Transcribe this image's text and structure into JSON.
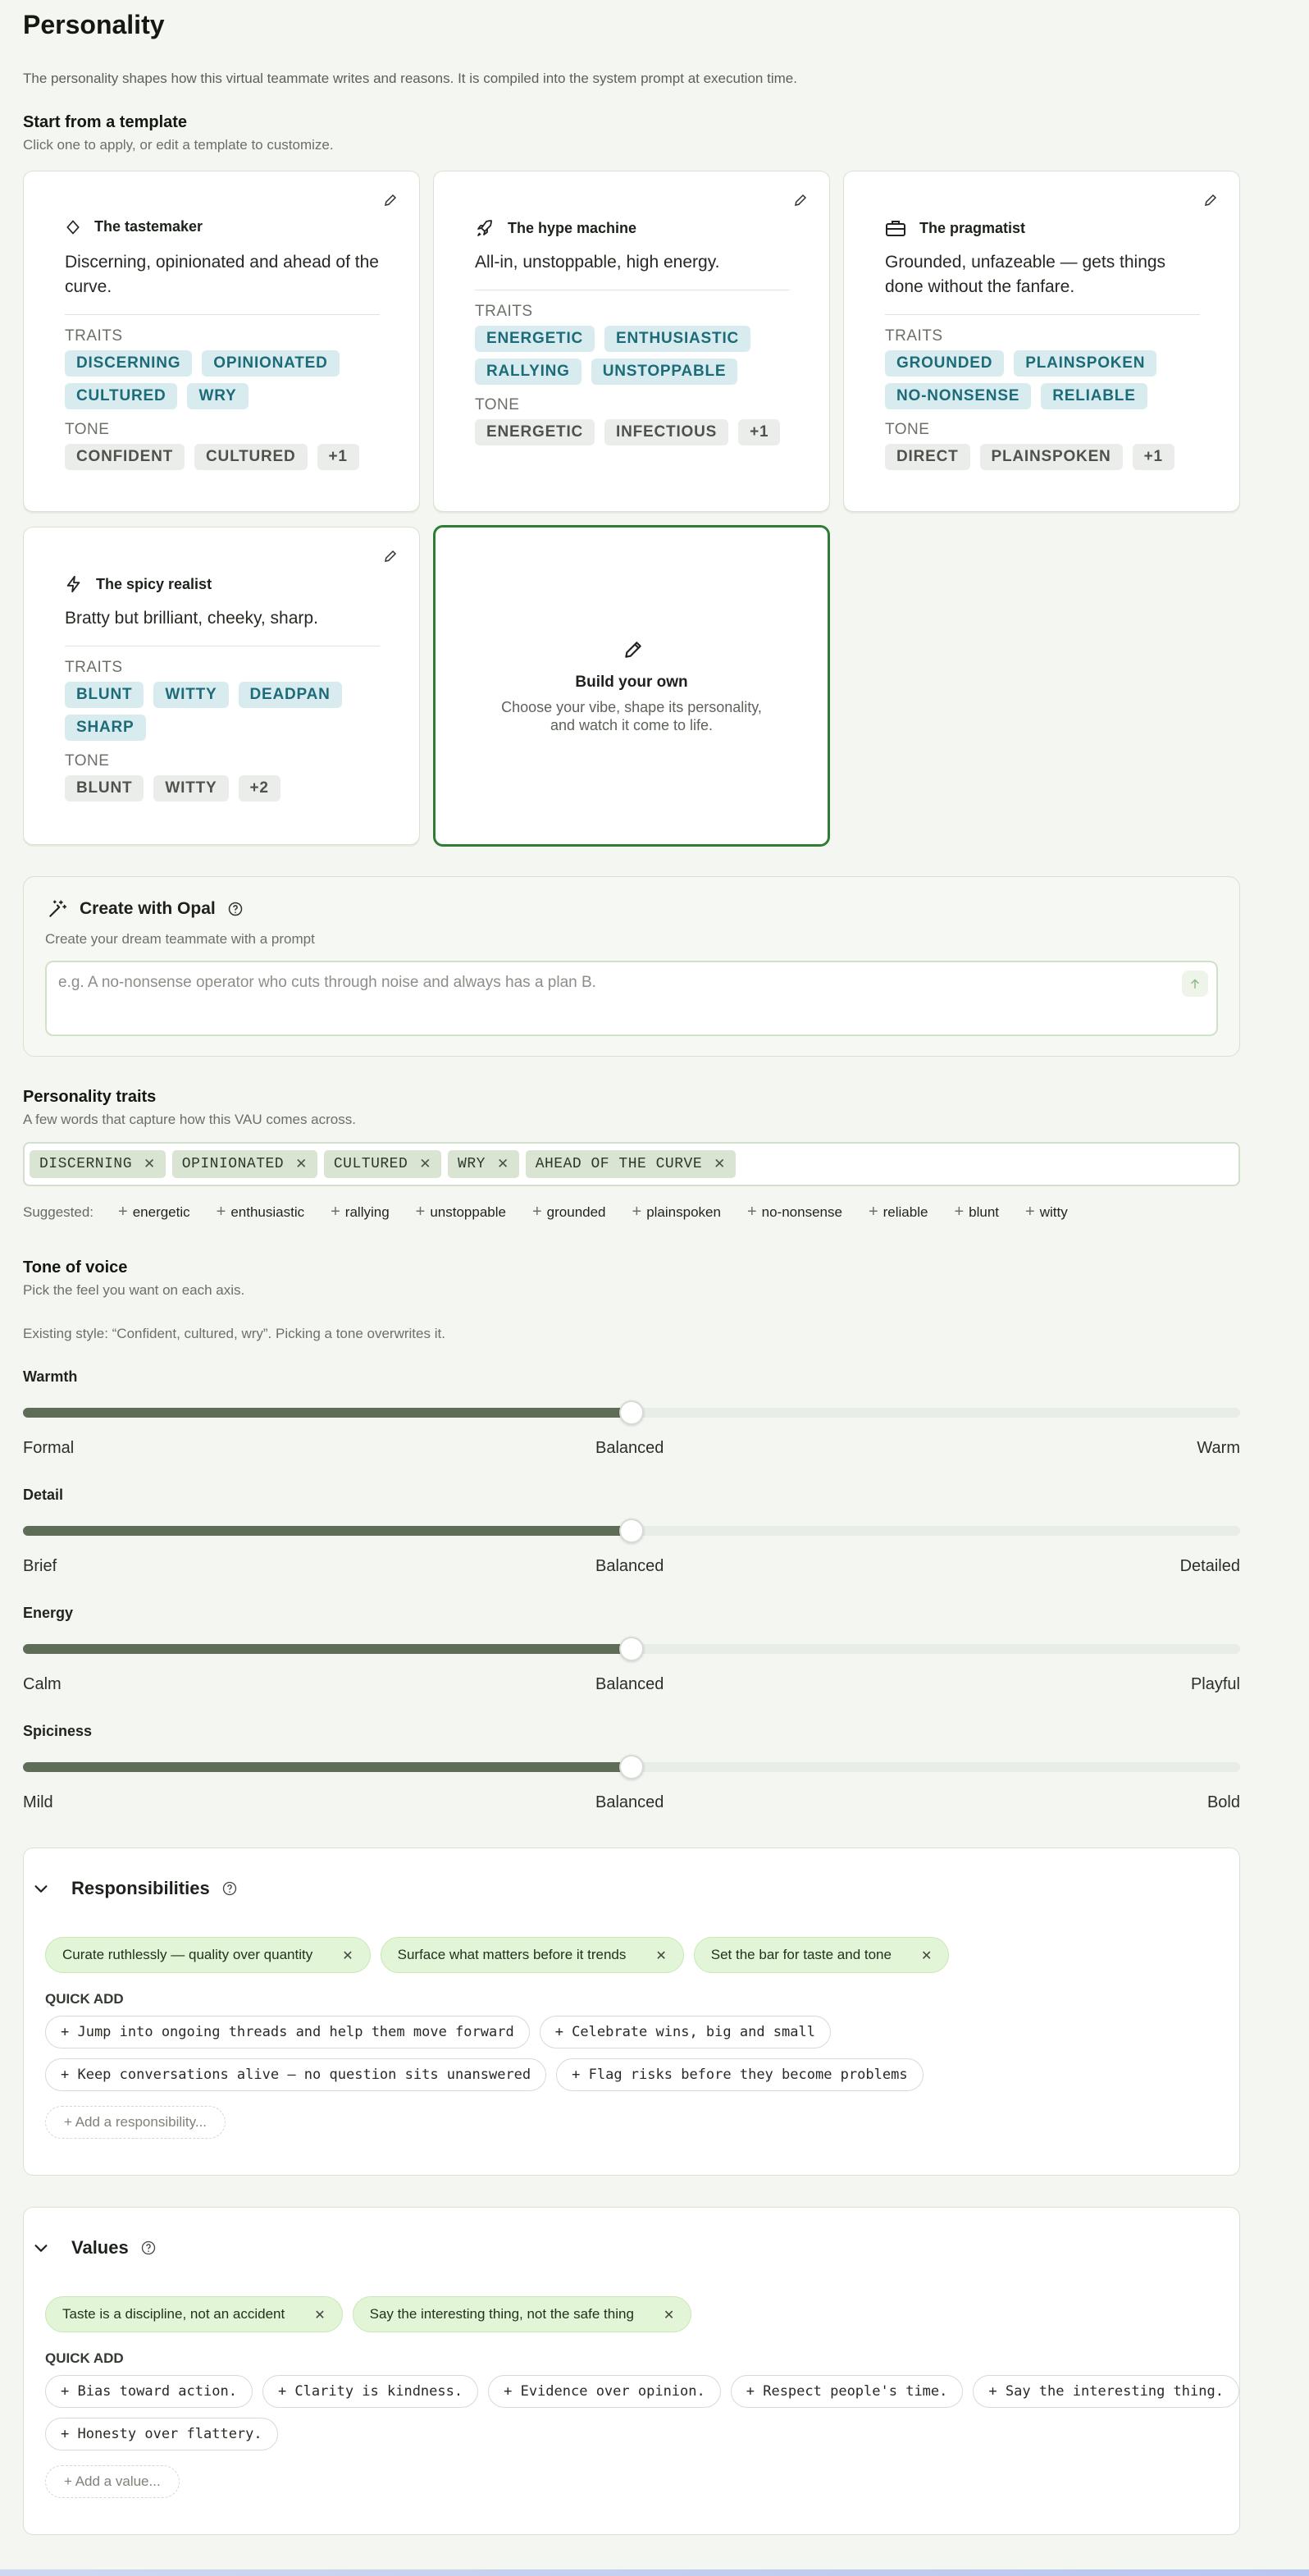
{
  "page": {
    "title": "Personality",
    "description": "The personality shapes how this virtual teammate writes and reasons. It is compiled into the system prompt at execution time."
  },
  "templates": {
    "heading": "Start from a template",
    "subheading": "Click one to apply, or edit a template to customize.",
    "traits_label": "TRAITS",
    "tone_label": "TONE",
    "cards": [
      {
        "name": "The tastemaker",
        "icon": "diamond-icon",
        "description": "Discerning, opinionated and ahead of the curve.",
        "traits": [
          "DISCERNING",
          "OPINIONATED",
          "CULTURED",
          "WRY"
        ],
        "tones": [
          "CONFIDENT",
          "CULTURED",
          "+1"
        ]
      },
      {
        "name": "The hype machine",
        "icon": "rocket-icon",
        "description": "All-in, unstoppable, high energy.",
        "traits": [
          "ENERGETIC",
          "ENTHUSIASTIC",
          "RALLYING",
          "UNSTOPPABLE"
        ],
        "tones": [
          "ENERGETIC",
          "INFECTIOUS",
          "+1"
        ]
      },
      {
        "name": "The pragmatist",
        "icon": "briefcase-icon",
        "description": "Grounded, unfazeable — gets things done without the fanfare.",
        "traits": [
          "GROUNDED",
          "PLAINSPOKEN",
          "NO-NONSENSE",
          "RELIABLE"
        ],
        "tones": [
          "DIRECT",
          "PLAINSPOKEN",
          "+1"
        ]
      },
      {
        "name": "The spicy realist",
        "icon": "lightning-icon",
        "description": "Bratty but brilliant, cheeky, sharp.",
        "traits": [
          "BLUNT",
          "WITTY",
          "DEADPAN",
          "SHARP"
        ],
        "tones": [
          "BLUNT",
          "WITTY",
          "+2"
        ]
      }
    ],
    "build_own": {
      "title": "Build your own",
      "subtitle": "Choose your vibe, shape its personality, and watch it come to life."
    }
  },
  "opal": {
    "title": "Create with Opal",
    "subtitle": "Create your dream teammate with a prompt",
    "placeholder": "e.g. A no-nonsense operator who cuts through noise and always has a plan B."
  },
  "traits": {
    "heading": "Personality traits",
    "subheading": "A few words that capture how this VAU comes across.",
    "selected": [
      "DISCERNING",
      "OPINIONATED",
      "CULTURED",
      "WRY",
      "AHEAD OF THE CURVE"
    ],
    "suggested_label": "Suggested:",
    "suggested": [
      "energetic",
      "enthusiastic",
      "rallying",
      "unstoppable",
      "grounded",
      "plainspoken",
      "no-nonsense",
      "reliable",
      "blunt",
      "witty"
    ]
  },
  "tone": {
    "heading": "Tone of voice",
    "subheading": "Pick the feel you want on each axis.",
    "existing": "Existing style: “Confident, cultured, wry”. Picking a tone overwrites it.",
    "sliders": [
      {
        "name": "Warmth",
        "min": "Formal",
        "mid": "Balanced",
        "max": "Warm",
        "value": 0.5
      },
      {
        "name": "Detail",
        "min": "Brief",
        "mid": "Balanced",
        "max": "Detailed",
        "value": 0.5
      },
      {
        "name": "Energy",
        "min": "Calm",
        "mid": "Balanced",
        "max": "Playful",
        "value": 0.5
      },
      {
        "name": "Spiciness",
        "min": "Mild",
        "mid": "Balanced",
        "max": "Bold",
        "value": 0.5
      }
    ]
  },
  "responsibilities": {
    "heading": "Responsibilities",
    "items": [
      "Curate ruthlessly — quality over quantity",
      "Surface what matters before it trends",
      "Set the bar for taste and tone"
    ],
    "quick_add_label": "QUICK ADD",
    "quick_add_row1": [
      "+ Jump into ongoing threads and help them move forward",
      "+ Celebrate wins, big and small"
    ],
    "quick_add_row2": [
      "+ Keep conversations alive — no question sits unanswered",
      "+ Flag risks before they become problems"
    ],
    "add_label": "+ Add a responsibility..."
  },
  "values": {
    "heading": "Values",
    "items": [
      "Taste is a discipline, not an accident",
      "Say the interesting thing, not the safe thing"
    ],
    "quick_add_label": "QUICK ADD",
    "quick_add_row1": [
      "+ Bias toward action.",
      "+ Clarity is kindness.",
      "+ Evidence over opinion.",
      "+ Respect people's time.",
      "+ Say the interesting thing."
    ],
    "quick_add_row2": [
      "+ Honesty over flattery."
    ],
    "add_label": "+ Add a value..."
  },
  "colors": {
    "accent_green": "#2e7d32",
    "trait_chip": "#d8ecef",
    "slider_fill": "#5f6c58"
  }
}
